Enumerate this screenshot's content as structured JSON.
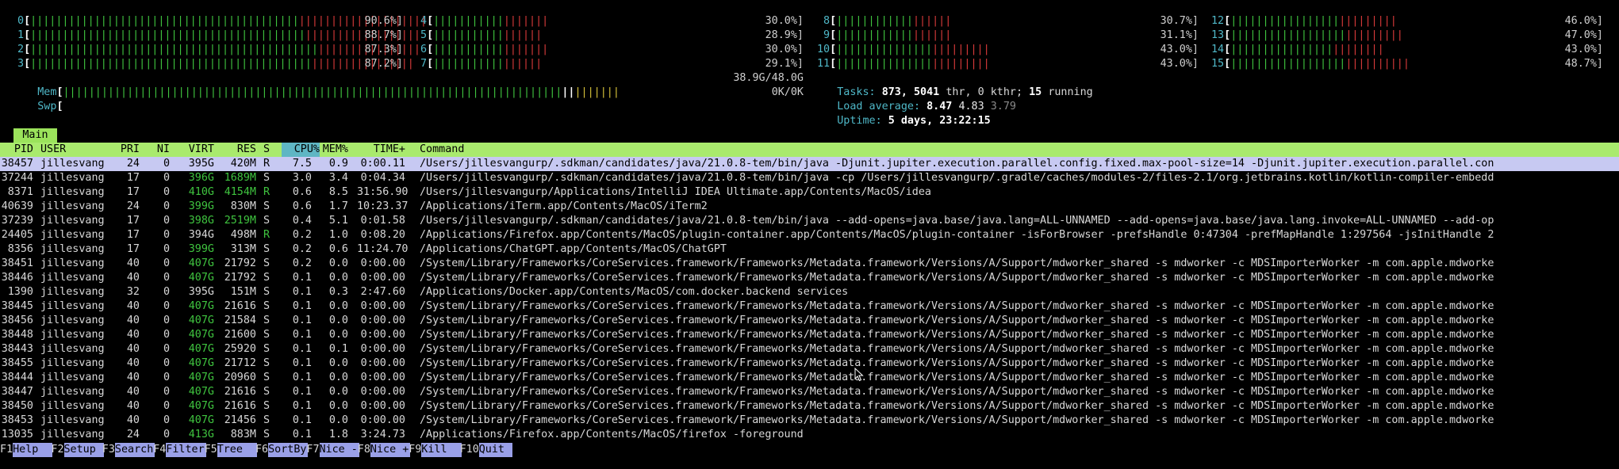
{
  "cpu_meters": [
    {
      "label": "0",
      "value": "90.6%",
      "green": 42,
      "red": 20
    },
    {
      "label": "1",
      "value": "88.7%",
      "green": 43,
      "red": 18
    },
    {
      "label": "2",
      "value": "87.3%",
      "green": 45,
      "red": 16
    },
    {
      "label": "3",
      "value": "87.2%",
      "green": 44,
      "red": 16
    },
    {
      "label": "4",
      "value": "30.0%",
      "green": 11,
      "red": 7
    },
    {
      "label": "5",
      "value": "28.9%",
      "green": 11,
      "red": 6
    },
    {
      "label": "6",
      "value": "30.0%",
      "green": 11,
      "red": 7
    },
    {
      "label": "7",
      "value": "29.1%",
      "green": 11,
      "red": 6
    },
    {
      "label": "8",
      "value": "30.7%",
      "green": 12,
      "red": 6
    },
    {
      "label": "9",
      "value": "31.1%",
      "green": 12,
      "red": 6
    },
    {
      "label": "10",
      "value": "43.0%",
      "green": 15,
      "red": 9
    },
    {
      "label": "11",
      "value": "43.0%",
      "green": 15,
      "red": 9
    },
    {
      "label": "12",
      "value": "46.0%",
      "green": 17,
      "red": 9
    },
    {
      "label": "13",
      "value": "47.0%",
      "green": 18,
      "red": 9
    },
    {
      "label": "14",
      "value": "43.0%",
      "green": 16,
      "red": 8
    },
    {
      "label": "15",
      "value": "48.7%",
      "green": 18,
      "red": 10
    }
  ],
  "mem": {
    "label": "Mem",
    "value": "38.9G/48.0G"
  },
  "swp": {
    "label": "Swp",
    "value": "0K/0K"
  },
  "tasks": {
    "label": "Tasks:",
    "count": "873,",
    "thr": "5041",
    "thr_label": "thr, 0 kthr;",
    "running": "15",
    "running_label": "running"
  },
  "load": {
    "label": "Load average:",
    "v1": "8.47",
    "v5": "4.83",
    "v15": "3.79"
  },
  "uptime": {
    "label": "Uptime:",
    "value": "5 days, 23:22:15"
  },
  "tab": {
    "label": "Main"
  },
  "columns": {
    "pid": "PID",
    "user": "USER",
    "pri": "PRI",
    "ni": "NI",
    "virt": "VIRT",
    "res": "RES",
    "s": "S",
    "cpu": "CPU%",
    "mem": "MEM%",
    "time": "TIME+",
    "command": "Command"
  },
  "processes": [
    {
      "pid": "38457",
      "user": "jillesvang",
      "pri": "24",
      "ni": "0",
      "virt": "395G",
      "res": "420M",
      "s": "R",
      "cpu": "7.5",
      "mem": "0.9",
      "time": "0:00.11",
      "command": "/Users/jillesvangurp/.sdkman/candidates/java/21.0.8-tem/bin/java -Djunit.jupiter.execution.parallel.config.fixed.max-pool-size=14 -Djunit.jupiter.execution.parallel.con"
    },
    {
      "pid": "37244",
      "user": "jillesvang",
      "pri": "17",
      "ni": "0",
      "virt": "396G",
      "res": "1689M",
      "s": "S",
      "cpu": "3.0",
      "mem": "3.4",
      "time": "0:04.34",
      "command": "/Users/jillesvangurp/.sdkman/candidates/java/21.0.8-tem/bin/java -cp /Users/jillesvangurp/.gradle/caches/modules-2/files-2.1/org.jetbrains.kotlin/kotlin-compiler-embedd"
    },
    {
      "pid": "8371",
      "user": "jillesvang",
      "pri": "17",
      "ni": "0",
      "virt": "410G",
      "res": "4154M",
      "s": "R",
      "cpu": "0.6",
      "mem": "8.5",
      "time": "31:56.90",
      "command": "/Users/jillesvangurp/Applications/IntelliJ IDEA Ultimate.app/Contents/MacOS/idea"
    },
    {
      "pid": "40639",
      "user": "jillesvang",
      "pri": "24",
      "ni": "0",
      "virt": "399G",
      "res": "830M",
      "s": "S",
      "cpu": "0.6",
      "mem": "1.7",
      "time": "10:23.37",
      "command": "/Applications/iTerm.app/Contents/MacOS/iTerm2"
    },
    {
      "pid": "37239",
      "user": "jillesvang",
      "pri": "17",
      "ni": "0",
      "virt": "398G",
      "res": "2519M",
      "s": "S",
      "cpu": "0.4",
      "mem": "5.1",
      "time": "0:01.58",
      "command": "/Users/jillesvangurp/.sdkman/candidates/java/21.0.8-tem/bin/java --add-opens=java.base/java.lang=ALL-UNNAMED --add-opens=java.base/java.lang.invoke=ALL-UNNAMED --add-op"
    },
    {
      "pid": "24405",
      "user": "jillesvang",
      "pri": "17",
      "ni": "0",
      "virt": "394G",
      "res": "498M",
      "s": "R",
      "cpu": "0.2",
      "mem": "1.0",
      "time": "0:08.20",
      "command": "/Applications/Firefox.app/Contents/MacOS/plugin-container.app/Contents/MacOS/plugin-container -isForBrowser -prefsHandle 0:47304 -prefMapHandle 1:297564 -jsInitHandle 2"
    },
    {
      "pid": "8356",
      "user": "jillesvang",
      "pri": "17",
      "ni": "0",
      "virt": "399G",
      "res": "313M",
      "s": "S",
      "cpu": "0.2",
      "mem": "0.6",
      "time": "11:24.70",
      "command": "/Applications/ChatGPT.app/Contents/MacOS/ChatGPT"
    },
    {
      "pid": "38451",
      "user": "jillesvang",
      "pri": "40",
      "ni": "0",
      "virt": "407G",
      "res": "21792",
      "s": "S",
      "cpu": "0.2",
      "mem": "0.0",
      "time": "0:00.00",
      "command": "/System/Library/Frameworks/CoreServices.framework/Frameworks/Metadata.framework/Versions/A/Support/mdworker_shared -s mdworker -c MDSImporterWorker -m com.apple.mdworke"
    },
    {
      "pid": "38446",
      "user": "jillesvang",
      "pri": "40",
      "ni": "0",
      "virt": "407G",
      "res": "21792",
      "s": "S",
      "cpu": "0.1",
      "mem": "0.0",
      "time": "0:00.00",
      "command": "/System/Library/Frameworks/CoreServices.framework/Frameworks/Metadata.framework/Versions/A/Support/mdworker_shared -s mdworker -c MDSImporterWorker -m com.apple.mdworke"
    },
    {
      "pid": "1390",
      "user": "jillesvang",
      "pri": "32",
      "ni": "0",
      "virt": "395G",
      "res": "151M",
      "s": "S",
      "cpu": "0.1",
      "mem": "0.3",
      "time": "2:47.60",
      "command": "/Applications/Docker.app/Contents/MacOS/com.docker.backend services"
    },
    {
      "pid": "38445",
      "user": "jillesvang",
      "pri": "40",
      "ni": "0",
      "virt": "407G",
      "res": "21616",
      "s": "S",
      "cpu": "0.1",
      "mem": "0.0",
      "time": "0:00.00",
      "command": "/System/Library/Frameworks/CoreServices.framework/Frameworks/Metadata.framework/Versions/A/Support/mdworker_shared -s mdworker -c MDSImporterWorker -m com.apple.mdworke"
    },
    {
      "pid": "38456",
      "user": "jillesvang",
      "pri": "40",
      "ni": "0",
      "virt": "407G",
      "res": "21584",
      "s": "S",
      "cpu": "0.1",
      "mem": "0.0",
      "time": "0:00.00",
      "command": "/System/Library/Frameworks/CoreServices.framework/Frameworks/Metadata.framework/Versions/A/Support/mdworker_shared -s mdworker -c MDSImporterWorker -m com.apple.mdworke"
    },
    {
      "pid": "38448",
      "user": "jillesvang",
      "pri": "40",
      "ni": "0",
      "virt": "407G",
      "res": "21600",
      "s": "S",
      "cpu": "0.1",
      "mem": "0.0",
      "time": "0:00.00",
      "command": "/System/Library/Frameworks/CoreServices.framework/Frameworks/Metadata.framework/Versions/A/Support/mdworker_shared -s mdworker -c MDSImporterWorker -m com.apple.mdworke"
    },
    {
      "pid": "38443",
      "user": "jillesvang",
      "pri": "40",
      "ni": "0",
      "virt": "407G",
      "res": "25920",
      "s": "S",
      "cpu": "0.1",
      "mem": "0.1",
      "time": "0:00.00",
      "command": "/System/Library/Frameworks/CoreServices.framework/Frameworks/Metadata.framework/Versions/A/Support/mdworker_shared -s mdworker -c MDSImporterWorker -m com.apple.mdworke"
    },
    {
      "pid": "38455",
      "user": "jillesvang",
      "pri": "40",
      "ni": "0",
      "virt": "407G",
      "res": "21712",
      "s": "S",
      "cpu": "0.1",
      "mem": "0.0",
      "time": "0:00.00",
      "command": "/System/Library/Frameworks/CoreServices.framework/Frameworks/Metadata.framework/Versions/A/Support/mdworker_shared -s mdworker -c MDSImporterWorker -m com.apple.mdworke"
    },
    {
      "pid": "38444",
      "user": "jillesvang",
      "pri": "40",
      "ni": "0",
      "virt": "407G",
      "res": "20960",
      "s": "S",
      "cpu": "0.1",
      "mem": "0.0",
      "time": "0:00.00",
      "command": "/System/Library/Frameworks/CoreServices.framework/Frameworks/Metadata.framework/Versions/A/Support/mdworker_shared -s mdworker -c MDSImporterWorker -m com.apple.mdworke"
    },
    {
      "pid": "38447",
      "user": "jillesvang",
      "pri": "40",
      "ni": "0",
      "virt": "407G",
      "res": "21616",
      "s": "S",
      "cpu": "0.1",
      "mem": "0.0",
      "time": "0:00.00",
      "command": "/System/Library/Frameworks/CoreServices.framework/Frameworks/Metadata.framework/Versions/A/Support/mdworker_shared -s mdworker -c MDSImporterWorker -m com.apple.mdworke"
    },
    {
      "pid": "38450",
      "user": "jillesvang",
      "pri": "40",
      "ni": "0",
      "virt": "407G",
      "res": "21616",
      "s": "S",
      "cpu": "0.1",
      "mem": "0.0",
      "time": "0:00.00",
      "command": "/System/Library/Frameworks/CoreServices.framework/Frameworks/Metadata.framework/Versions/A/Support/mdworker_shared -s mdworker -c MDSImporterWorker -m com.apple.mdworke"
    },
    {
      "pid": "38453",
      "user": "jillesvang",
      "pri": "40",
      "ni": "0",
      "virt": "407G",
      "res": "21456",
      "s": "S",
      "cpu": "0.1",
      "mem": "0.0",
      "time": "0:00.00",
      "command": "/System/Library/Frameworks/CoreServices.framework/Frameworks/Metadata.framework/Versions/A/Support/mdworker_shared -s mdworker -c MDSImporterWorker -m com.apple.mdworke"
    },
    {
      "pid": "13035",
      "user": "jillesvang",
      "pri": "24",
      "ni": "0",
      "virt": "413G",
      "res": "883M",
      "s": "S",
      "cpu": "0.1",
      "mem": "1.8",
      "time": "3:24.73",
      "command": "/Applications/Firefox.app/Contents/MacOS/firefox -foreground"
    }
  ],
  "footer": [
    {
      "key": "F1",
      "label": "Help  "
    },
    {
      "key": "F2",
      "label": "Setup "
    },
    {
      "key": "F3",
      "label": "Search"
    },
    {
      "key": "F4",
      "label": "Filter"
    },
    {
      "key": "F5",
      "label": "Tree  "
    },
    {
      "key": "F6",
      "label": "SortBy"
    },
    {
      "key": "F7",
      "label": "Nice -"
    },
    {
      "key": "F8",
      "label": "Nice +"
    },
    {
      "key": "F9",
      "label": "Kill  "
    },
    {
      "key": "F10",
      "label": "Quit "
    }
  ],
  "colors": {
    "header_bg": "#a9ea6d",
    "tab_bg": "#9be35b",
    "selected_row": "#c7c9f2",
    "footer_action": "#9aa0e8",
    "meter_green": "#3fc43f",
    "meter_red": "#d83a3a",
    "label_cyan": "#4fb8c8"
  }
}
